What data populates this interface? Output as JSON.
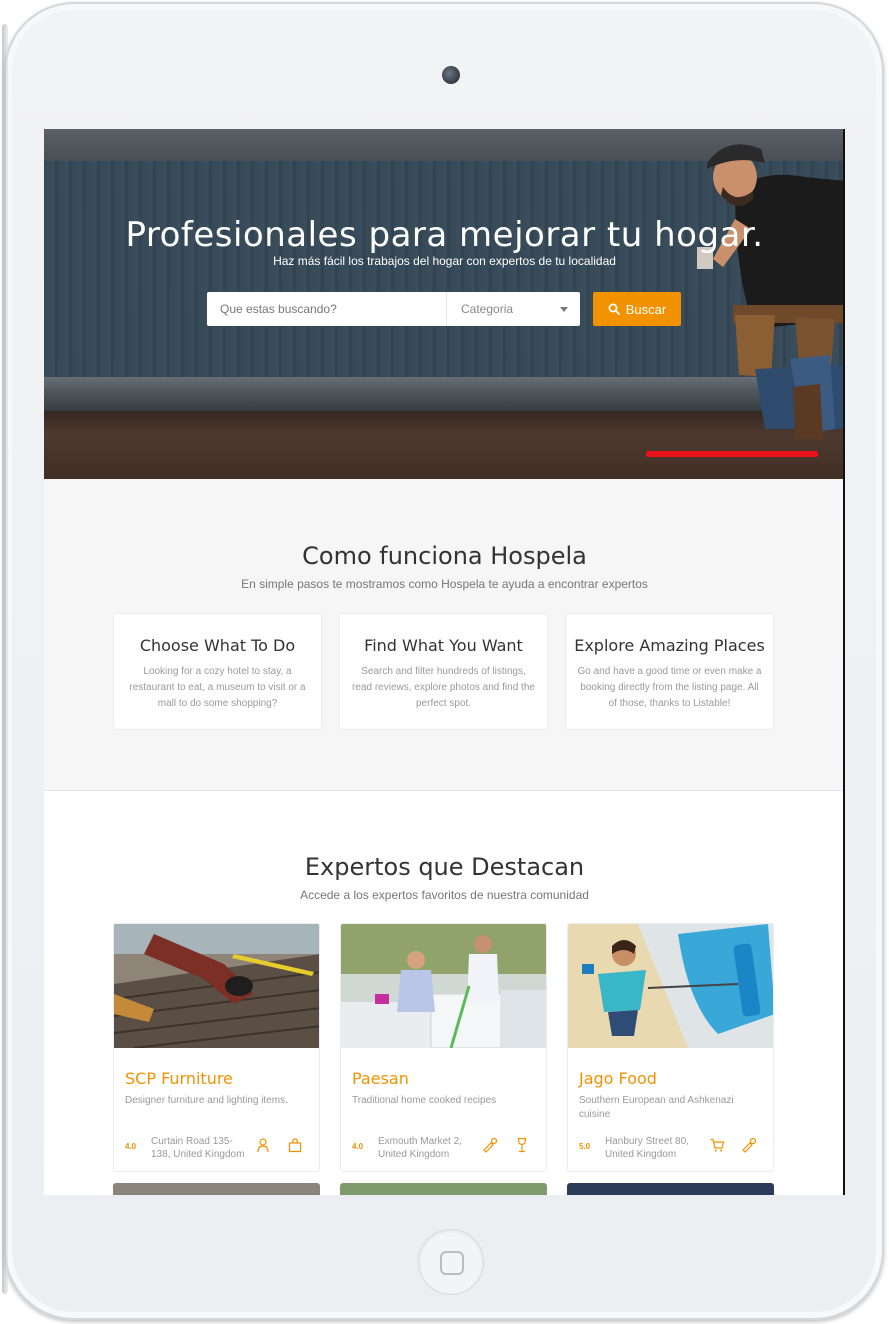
{
  "hero": {
    "title": "Profesionales para mejorar tu hogar.",
    "subtitle": "Haz más fácil los trabajos del hogar con expertos de tu localidad",
    "search_placeholder": "Que estas buscando?",
    "category_label": "Categoria",
    "search_button": "Buscar",
    "accent_color": "#f39200",
    "slider_indicator_color": "#e8121a"
  },
  "how": {
    "title": "Como funciona Hospela",
    "subtitle": "En simple pasos te mostramos como Hospela te ayuda a encontrar expertos",
    "steps": [
      {
        "title": "Choose What To Do",
        "text": "Looking for a cozy hotel to stay, a restaurant to eat, a museum to visit or a mall to do some shopping?"
      },
      {
        "title": "Find What You Want",
        "text": "Search and filter hundreds of listings, read reviews, explore photos and find the perfect spot."
      },
      {
        "title": "Explore Amazing Places",
        "text": "Go and have a good time or even make a booking directly from the listing page. All of those, thanks to Listable!"
      }
    ]
  },
  "experts": {
    "title": "Expertos que Destacan",
    "subtitle": "Accede a los expertos favoritos de nuestra comunidad",
    "cards": [
      {
        "name": "SCP Furniture",
        "desc": "Designer furniture and lighting items.",
        "rating": "4.0",
        "address": "Curtain Road 135-138, United Kingdom",
        "icons": [
          "person-icon",
          "shopping-bag-icon"
        ]
      },
      {
        "name": "Paesan",
        "desc": "Traditional home cooked recipes",
        "rating": "4.0",
        "address": "Exmouth Market 2, United Kingdom",
        "icons": [
          "cooking-icon",
          "wine-glass-icon"
        ]
      },
      {
        "name": "Jago Food",
        "desc": "Southern European and Ashkenazi cuisine",
        "rating": "5.0",
        "address": "Hanbury Street 80, United Kingdom",
        "icons": [
          "cart-icon",
          "cooking-icon"
        ]
      }
    ]
  }
}
